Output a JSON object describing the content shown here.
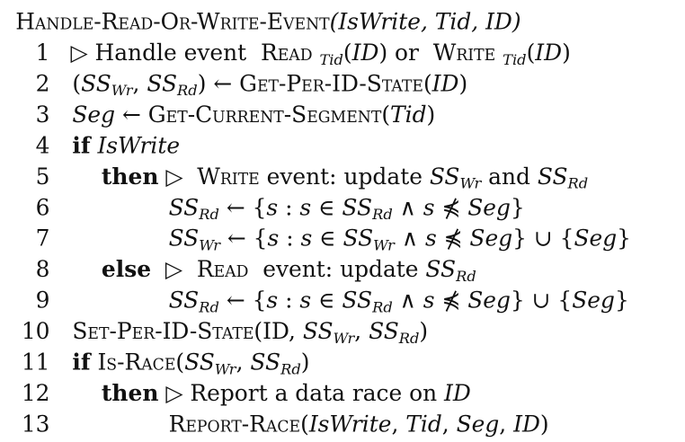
{
  "header": {
    "proc_name": "Handle-Read-Or-Write-Event",
    "params": "(IsWrite, Tid, ID)"
  },
  "lines": [
    {
      "num": "1",
      "text": "▷ Handle event  Read Tid(ID) or  Write Tid(ID)"
    },
    {
      "num": "2",
      "text": "(SSWr, SSRd) ← Get-Per-ID-State(ID)"
    },
    {
      "num": "3",
      "text": "Seg ← Get-Current-Segment(Tid)"
    },
    {
      "num": "4",
      "text": "if IsWrite"
    },
    {
      "num": "5",
      "text": "then ▷  Write event: update SSWr and SSRd"
    },
    {
      "num": "6",
      "text": "SSRd ← {s : s ∈ SSRd ∧ s ⋠ Seg}"
    },
    {
      "num": "7",
      "text": "SSWr ← {s : s ∈ SSWr ∧ s ⋠ Seg} ∪ {Seg}"
    },
    {
      "num": "8",
      "text": "else  ▷  Read  event: update SSRd"
    },
    {
      "num": "9",
      "text": "SSRd ← {s : s ∈ SSRd ∧ s ⋠ Seg} ∪ {Seg}"
    },
    {
      "num": "10",
      "text": "Set-Per-ID-State(ID, SSWr, SSRd)"
    },
    {
      "num": "11",
      "text": "if Is-Race(SSWr, SSRd)"
    },
    {
      "num": "12",
      "text": "then ▷ Report a data race on ID"
    },
    {
      "num": "13",
      "text": "Report-Race(IsWrite, Tid, Seg, ID)"
    }
  ]
}
